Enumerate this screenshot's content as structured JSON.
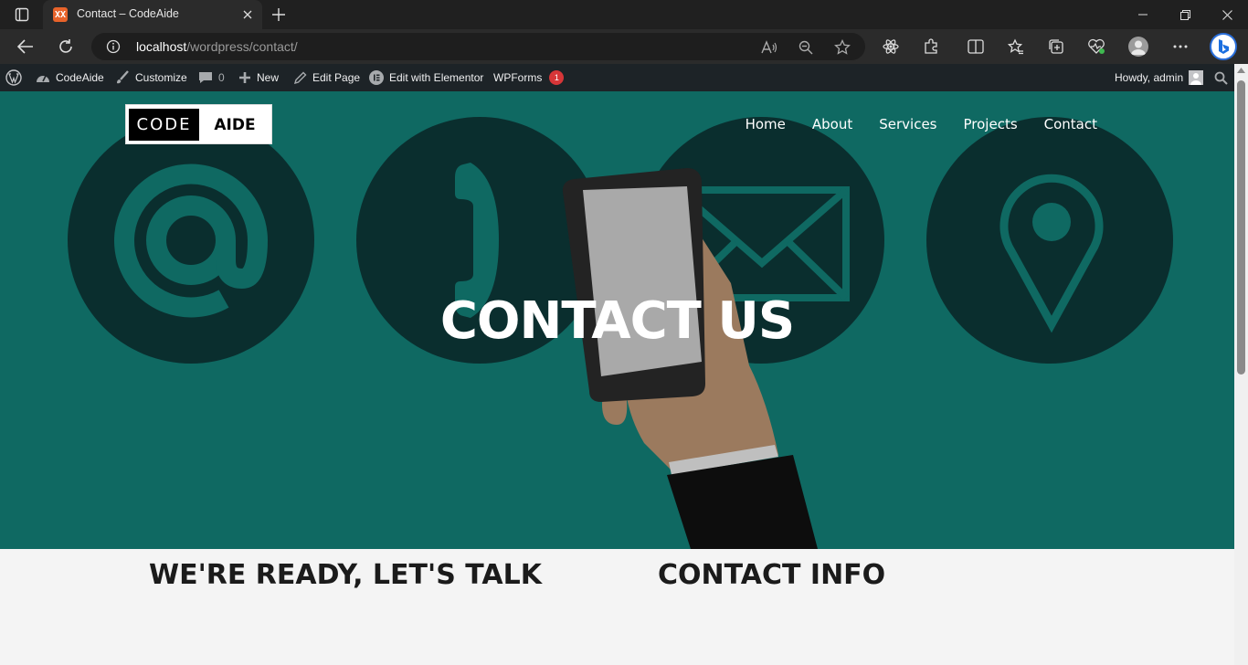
{
  "browser": {
    "tab_title": "Contact – CodeAide",
    "favicon_text": "XX",
    "url_host": "localhost",
    "url_path": "/wordpress/contact/"
  },
  "wp_admin_bar": {
    "site_name": "CodeAide",
    "customize": "Customize",
    "comments_count": "0",
    "new": "New",
    "edit_page": "Edit Page",
    "edit_elementor": "Edit with Elementor",
    "wpforms": "WPForms",
    "wpforms_badge": "1",
    "howdy": "Howdy, admin"
  },
  "site": {
    "logo_left": "CODE",
    "logo_right": "AIDE",
    "nav": [
      "Home",
      "About",
      "Services",
      "Projects",
      "Contact"
    ]
  },
  "hero": {
    "title": "CONTACT US",
    "bg_color": "#0f6962"
  },
  "sections": {
    "left_heading": "WE'RE READY, LET'S TALK",
    "right_heading": "CONTACT INFO"
  }
}
